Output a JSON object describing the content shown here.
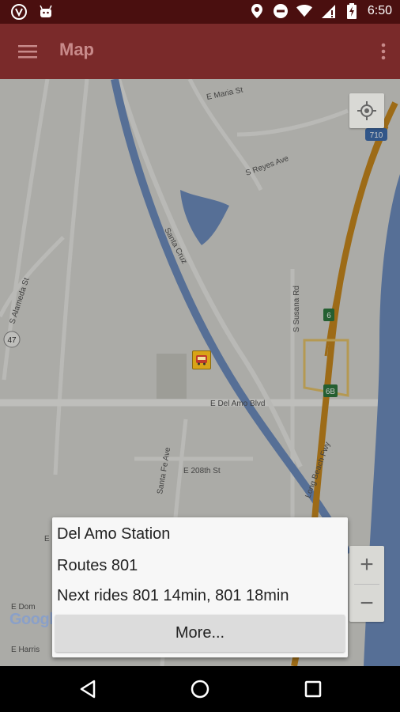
{
  "status_bar": {
    "time": "6:50",
    "icons": [
      "shield-app-icon",
      "android-app-icon",
      "location-pin-icon",
      "do-not-disturb-icon",
      "wifi-icon",
      "signal-icon",
      "battery-charging-icon"
    ]
  },
  "app_bar": {
    "title": "Map",
    "menu_icon": "hamburger-menu-icon",
    "overflow_icon": "more-vertical-icon"
  },
  "map": {
    "street_labels": {
      "maria": "E Maria St",
      "reyes": "S Reyes Ave",
      "santa_cruz": "Santa Cruz",
      "alameda": "S Alameda St",
      "susana": "S Susana Rd",
      "del_amo": "E Del Amo Blvd",
      "santa_fe": "Santa Fe Ave",
      "e208": "E 208th St",
      "long_beach": "Long Beach Fwy",
      "dom": "E Dom",
      "harris": "E Harris",
      "e_short": "E"
    },
    "shields": {
      "i710": "710",
      "r47": "47",
      "exit6": "6",
      "exit6b": "6B"
    },
    "attribution": "Google",
    "zoom_in_label": "+",
    "zoom_out_label": "−"
  },
  "popup": {
    "station": "Del Amo Station",
    "routes": "Routes  801",
    "next_rides": "Next rides  801 14min, 801 18min",
    "more_button": "More..."
  },
  "colors": {
    "status_bar": "#4a0f0f",
    "app_bar": "#7a2a2a",
    "freeway": "#c98a1e",
    "river": "#6f8fc0"
  }
}
